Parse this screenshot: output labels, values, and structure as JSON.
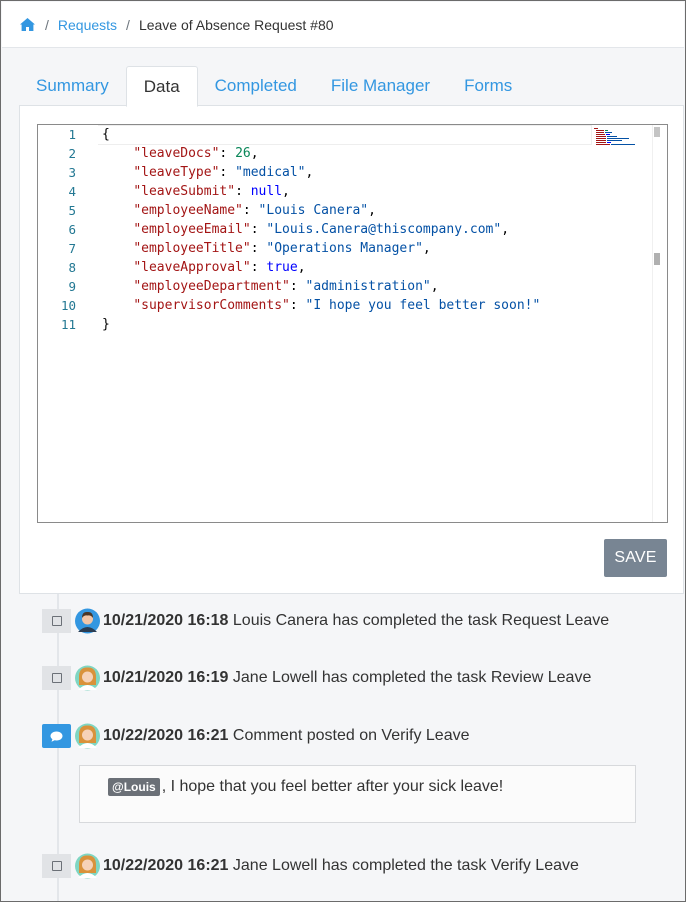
{
  "breadcrumb": {
    "home_icon": "home-icon",
    "separator": "/",
    "link": "Requests",
    "current": "Leave of Absence Request #80"
  },
  "tabs": [
    {
      "label": "Summary",
      "active": false
    },
    {
      "label": "Data",
      "active": true
    },
    {
      "label": "Completed",
      "active": false
    },
    {
      "label": "File Manager",
      "active": false
    },
    {
      "label": "Forms",
      "active": false
    }
  ],
  "editor": {
    "lines": [
      {
        "num": "1",
        "text": "{"
      },
      {
        "num": "2",
        "key": "\"leaveDocs\"",
        "value": "26",
        "vtype": "num",
        "comma": ","
      },
      {
        "num": "3",
        "key": "\"leaveType\"",
        "value": "\"medical\"",
        "vtype": "str",
        "comma": ","
      },
      {
        "num": "4",
        "key": "\"leaveSubmit\"",
        "value": "null",
        "vtype": "lit",
        "comma": ","
      },
      {
        "num": "5",
        "key": "\"employeeName\"",
        "value": "\"Louis Canera\"",
        "vtype": "str",
        "comma": ","
      },
      {
        "num": "6",
        "key": "\"employeeEmail\"",
        "value": "\"Louis.Canera@thiscompany.com\"",
        "vtype": "str",
        "comma": ","
      },
      {
        "num": "7",
        "key": "\"employeeTitle\"",
        "value": "\"Operations Manager\"",
        "vtype": "str",
        "comma": ","
      },
      {
        "num": "8",
        "key": "\"leaveApproval\"",
        "value": "true",
        "vtype": "lit",
        "comma": ","
      },
      {
        "num": "9",
        "key": "\"employeeDepartment\"",
        "value": "\"administration\"",
        "vtype": "str",
        "comma": ","
      },
      {
        "num": "10",
        "key": "\"supervisorComments\"",
        "value": "\"I hope you feel better soon!\"",
        "vtype": "str",
        "comma": ""
      },
      {
        "num": "11",
        "text": "}"
      }
    ]
  },
  "save_label": "SAVE",
  "timeline": [
    {
      "icon": "checkbox-icon",
      "avatar": "male-avatar",
      "timestamp": "10/21/2020 16:18",
      "text": "Louis Canera has completed the task Request Leave"
    },
    {
      "icon": "checkbox-icon",
      "avatar": "female-avatar",
      "timestamp": "10/21/2020 16:19",
      "text": "Jane Lowell has completed the task Review Leave"
    },
    {
      "icon": "comment-icon",
      "avatar": "female-avatar",
      "timestamp": "10/22/2020 16:21",
      "text": "Comment posted on Verify Leave"
    },
    {
      "icon": "checkbox-icon",
      "avatar": "female-avatar",
      "timestamp": "10/22/2020 16:21",
      "text": "Jane Lowell has completed the task Verify Leave"
    }
  ],
  "comment": {
    "mention": "@Louis",
    "text": ", I hope that you feel better after your sick leave!"
  },
  "colors": {
    "link": "#3397e1",
    "save_button": "#788593",
    "json_key": "#a31515",
    "json_string": "#0451a5",
    "json_number": "#098658",
    "json_literal": "#0000ff"
  }
}
